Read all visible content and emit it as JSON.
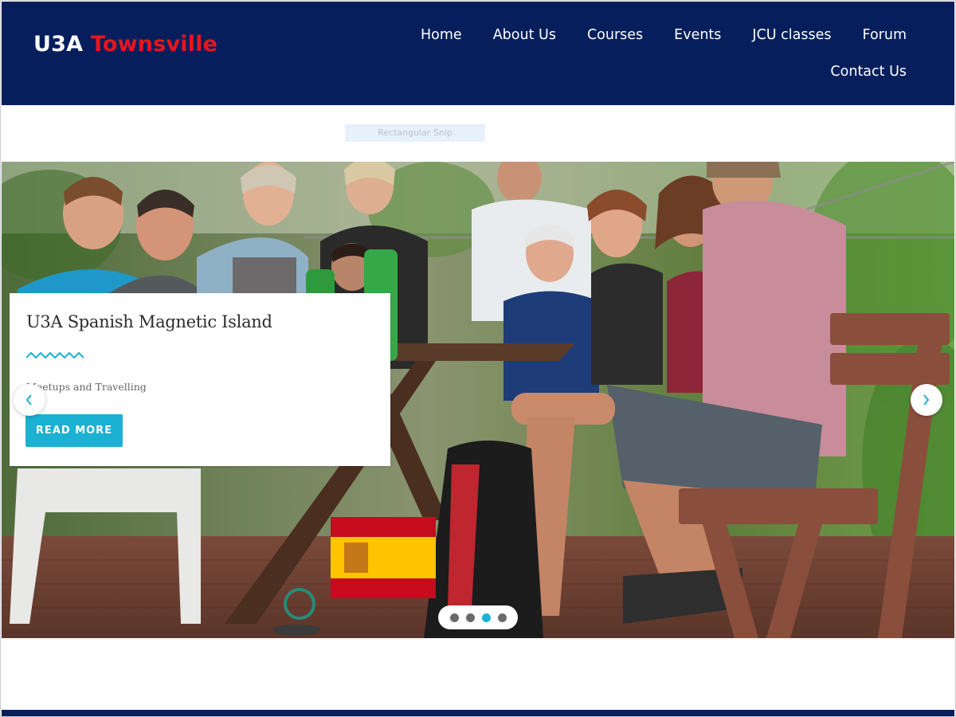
{
  "site": {
    "logo_part1": "U3A",
    "logo_part2": "Townsville",
    "brand_color": "#061f5c",
    "logo_accent_color": "#e8141f"
  },
  "nav": {
    "row1": [
      "Home",
      "About Us",
      "Courses",
      "Events",
      "JCU classes",
      "Forum"
    ],
    "row2": [
      "Contact Us"
    ]
  },
  "snip_label": "Rectangular Snip",
  "slider": {
    "slide_title": "U3A Spanish Magnetic Island",
    "slide_subtitle": "Meetups and Travelling",
    "cta_label": "READ MORE",
    "accent_color": "#1ab1d2",
    "prev_icon": "chevron-left-icon",
    "next_icon": "chevron-right-icon",
    "total_slides": 4,
    "active_slide": 3
  }
}
